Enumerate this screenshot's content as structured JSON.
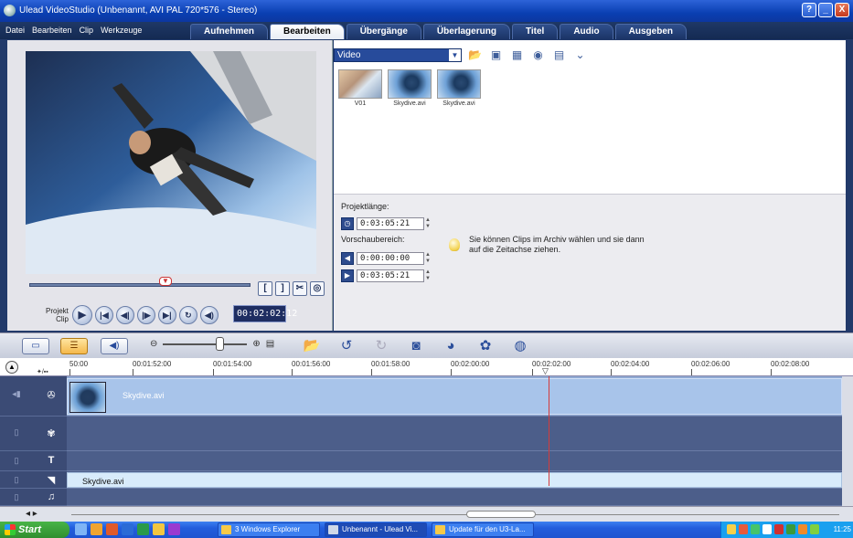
{
  "window": {
    "title": "Ulead VideoStudio (Unbenannt, AVI PAL 720*576 - Stereo)",
    "buttons": [
      "?",
      "_",
      "X"
    ]
  },
  "menu": {
    "items": [
      "Datei",
      "Bearbeiten",
      "Clip",
      "Werkzeuge"
    ]
  },
  "steps": {
    "items": [
      "Aufnehmen",
      "Bearbeiten",
      "Übergänge",
      "Überlagerung",
      "Titel",
      "Audio",
      "Ausgeben"
    ],
    "active": "Bearbeiten"
  },
  "preview": {
    "mode_projekt": "Projekt",
    "mode_clip": "Clip",
    "timecode": "00:02:02:12",
    "trim_start": "[",
    "trim_end": "]",
    "transport_icons": [
      "play-icon",
      "home-icon",
      "prev-frame-icon",
      "next-frame-icon",
      "end-icon",
      "repeat-icon",
      "volume-icon"
    ]
  },
  "library": {
    "category": "Video",
    "clips": [
      {
        "label": "V01"
      },
      {
        "label": "Skydive.avi"
      },
      {
        "label": "Skydive.avi"
      }
    ]
  },
  "options": {
    "projektlaenge_label": "Projektlänge:",
    "projektlaenge_value": "0:03:05:21",
    "vorschau_label": "Vorschaubereich:",
    "vorschau_start": "0:00:00:00",
    "vorschau_end": "0:03:05:21",
    "hint": "Sie können Clips im Archiv wählen und sie dann auf die Zeitachse ziehen."
  },
  "timeline": {
    "ruler_ticks": [
      "50:00",
      "00:01:52:00",
      "00:01:54:00",
      "00:01:56:00",
      "00:01:58:00",
      "00:02:00:00",
      "00:02:02:00",
      "00:02:04:00",
      "00:02:06:00",
      "00:02:08:00"
    ],
    "video_clip": "Skydive.avi",
    "voice_clip": "Skydive.avi",
    "track_icons": [
      "video-track-icon",
      "overlay-track-icon",
      "title-track-icon",
      "voice-track-icon",
      "music-track-icon"
    ]
  },
  "taskbar": {
    "start": "Start",
    "tasks": [
      "3 Windows Explorer",
      "Unbenannt - Ulead Vi...",
      "Update für den U3-La..."
    ],
    "clock": "11:25"
  },
  "colors": {
    "titlebar": "#0a3fb2",
    "app_bg": "#223a6a",
    "track_bg": "#4c5e8a",
    "clip": "#a8c4ea",
    "active_tab": "#ffffff",
    "playhead": "#d43b3b"
  }
}
